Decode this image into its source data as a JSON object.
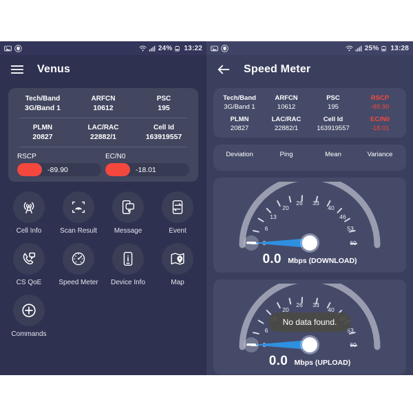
{
  "left_phone": {
    "statusbar": {
      "icons": [
        "image-icon",
        "shield-icon"
      ],
      "wifi": "wifi-icon",
      "signal": "signal-bars-icon",
      "battery_percent": "24%",
      "battery": "battery-icon",
      "time": "13:22"
    },
    "appbar": {
      "nav_icon": "hamburger-menu-icon",
      "title": "Venus"
    },
    "info_card": {
      "row1": [
        {
          "label": "Tech/Band",
          "value": "3G/Band 1"
        },
        {
          "label": "ARFCN",
          "value": "10612"
        },
        {
          "label": "PSC",
          "value": "195"
        }
      ],
      "row2": [
        {
          "label": "PLMN",
          "value": "20827"
        },
        {
          "label": "LAC/RAC",
          "value": "22882/1"
        },
        {
          "label": "Cell Id",
          "value": "163919557"
        }
      ],
      "signals": [
        {
          "label": "RSCP",
          "value": "-89.90",
          "color": "#f4483f"
        },
        {
          "label": "EC/N0",
          "value": "-18.01",
          "color": "#f4483f"
        }
      ]
    },
    "grid": [
      {
        "icon": "cell-tower-icon",
        "label": "Cell Info"
      },
      {
        "icon": "scan-radar-icon",
        "label": "Scan Result"
      },
      {
        "icon": "message-bubble-icon",
        "label": "Message"
      },
      {
        "icon": "event-exchange-icon",
        "label": "Event"
      },
      {
        "icon": "call-quality-icon",
        "label": "CS QoE"
      },
      {
        "icon": "speedometer-icon",
        "label": "Speed Meter"
      },
      {
        "icon": "device-info-icon",
        "label": "Device Info"
      },
      {
        "icon": "map-pin-icon",
        "label": "Map"
      },
      {
        "icon": "plus-circle-icon",
        "label": "Commands"
      }
    ]
  },
  "right_phone": {
    "statusbar": {
      "icons": [
        "image-icon",
        "shield-icon"
      ],
      "wifi": "wifi-icon",
      "signal": "signal-bars-icon",
      "battery_percent": "25%",
      "battery": "battery-icon",
      "time": "13:28"
    },
    "appbar": {
      "nav_icon": "back-arrow-icon",
      "title": "Speed Meter"
    },
    "info_card": {
      "row1": [
        {
          "label": "Tech/Band",
          "value": "3G/Band 1",
          "red": false
        },
        {
          "label": "ARFCN",
          "value": "10612",
          "red": false
        },
        {
          "label": "PSC",
          "value": "195",
          "red": false
        },
        {
          "label": "RSCP",
          "value": "-89.90",
          "red": true
        }
      ],
      "row2": [
        {
          "label": "PLMN",
          "value": "20827",
          "red": false
        },
        {
          "label": "LAC/RAC",
          "value": "22882/1",
          "red": false
        },
        {
          "label": "Cell Id",
          "value": "163919557",
          "red": false
        },
        {
          "label": "EC/N0",
          "value": "-18.01",
          "red": true
        }
      ]
    },
    "tabs": [
      "Deviation",
      "Ping",
      "Mean",
      "Variance"
    ],
    "toast": "No data found.",
    "gauges": [
      {
        "name": "download-gauge",
        "value": "0.0",
        "unit": "Mbps (DOWNLOAD)",
        "ticks": [
          "0",
          "6",
          "13",
          "20",
          "26",
          "33",
          "40",
          "46",
          "53",
          "60"
        ],
        "min": 0,
        "max": 60,
        "needle_value": 0,
        "arc_color": "#9a9cb0",
        "needle_color": "#2f90e0"
      },
      {
        "name": "upload-gauge",
        "value": "0.0",
        "unit": "Mbps (UPLOAD)",
        "ticks": [
          "0",
          "6",
          "13",
          "20",
          "26",
          "33",
          "40",
          "46",
          "53",
          "60"
        ],
        "min": 0,
        "max": 60,
        "needle_value": 0,
        "arc_color": "#9a9cb0",
        "needle_color": "#2f90e0"
      }
    ]
  },
  "chart_data": {
    "type": "gauge",
    "title": "Speed Meter",
    "gauges": [
      {
        "label": "Mbps (DOWNLOAD)",
        "value": 0.0,
        "min": 0,
        "max": 60,
        "ticks": [
          0,
          6,
          13,
          20,
          26,
          33,
          40,
          46,
          53,
          60
        ]
      },
      {
        "label": "Mbps (UPLOAD)",
        "value": 0.0,
        "min": 0,
        "max": 60,
        "ticks": [
          0,
          6,
          13,
          20,
          26,
          33,
          40,
          46,
          53,
          60
        ]
      }
    ]
  }
}
